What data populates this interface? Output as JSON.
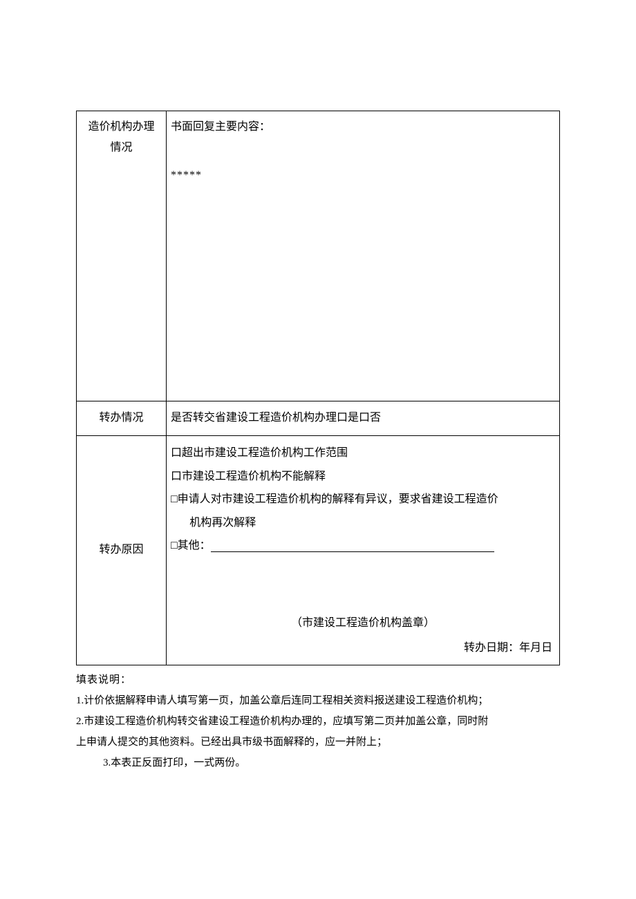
{
  "row1": {
    "label_line1": "造价机构办理",
    "label_line2": "情况",
    "content_heading": "书面回复主要内容：",
    "stars": "*****"
  },
  "row2": {
    "label": "转办情况",
    "content": "是否转交省建设工程造价机构办理口是口否"
  },
  "row3": {
    "label": "转办原因",
    "opt1": "口超出市建设工程造价机构工作范围",
    "opt2": "口市建设工程造价机构不能解释",
    "opt3_line1": "□申请人对市建设工程造价机构的解释有异议，要求省建设工程造价",
    "opt3_line2": "机构再次解释",
    "opt4_prefix": "□其他：",
    "seal": "（市建设工程造价机构盖章）",
    "date": "转办日期：年月日"
  },
  "notes": {
    "heading": "填表说明：",
    "n1": "1.计价依据解释申请人填写第一页，加盖公章后连同工程相关资料报送建设工程造价机构；",
    "n2": "2.市建设工程造价机构转交省建设工程造价机构办理的，应填写第二页并加盖公章，同时附",
    "n2b": "上申请人提交的其他资料。已经出具市级书面解释的，应一并附上；",
    "n3": "3.本表正反面打印，一式两份。"
  }
}
